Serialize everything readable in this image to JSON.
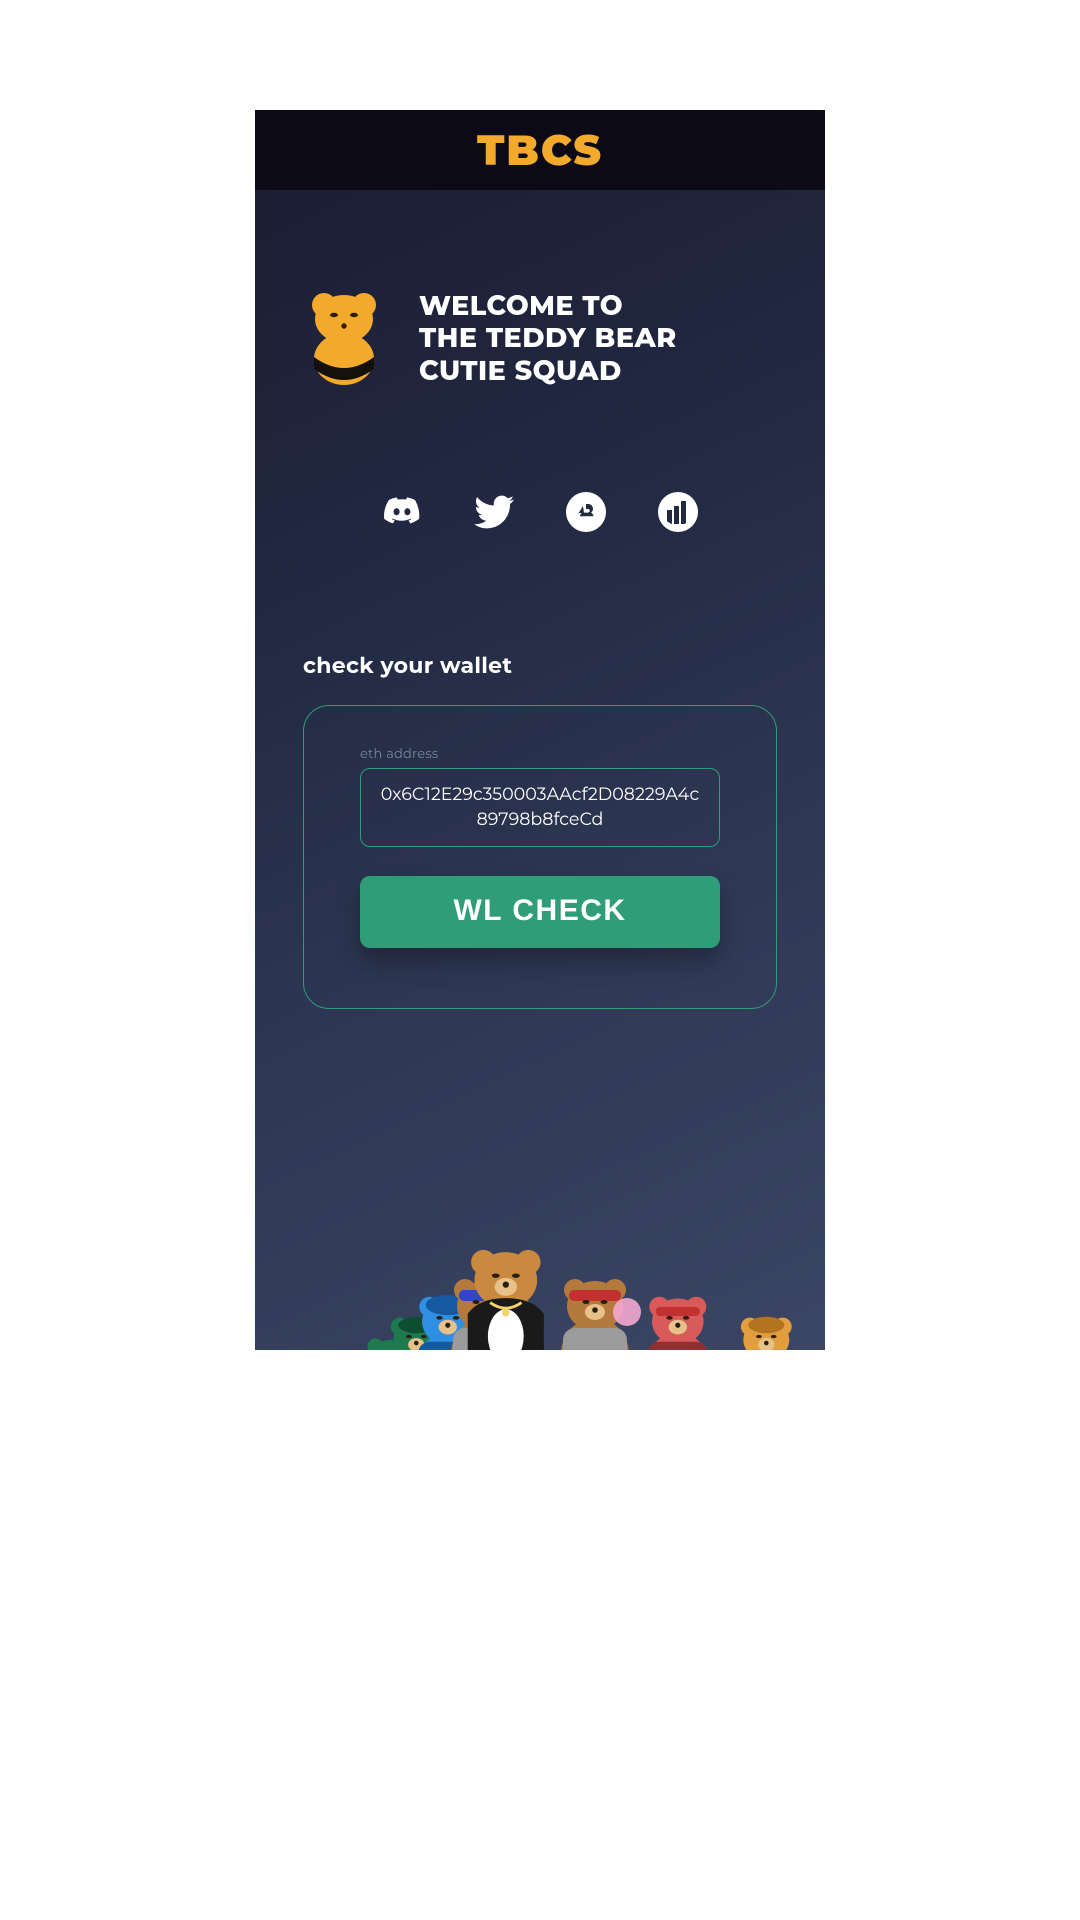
{
  "header": {
    "brand": "TBCS"
  },
  "hero": {
    "title": "WELCOME TO\nTHE TEDDY BEAR\nCUTIE SQUAD"
  },
  "socials": {
    "items": [
      {
        "name": "discord-icon"
      },
      {
        "name": "twitter-icon"
      },
      {
        "name": "opensea-icon"
      },
      {
        "name": "looksrare-icon"
      }
    ]
  },
  "wallet": {
    "section_title": "check your wallet",
    "field_label": "eth address",
    "address_value": "0x6C12E29c350003AAcf2D08229A4c89798b8fceCd",
    "button_label": "WL CHECK"
  },
  "colors": {
    "accent": "#f3a92b",
    "button": "#2f9d77",
    "border": "#2f9d77",
    "bg_dark": "#0d0a17"
  },
  "footer": {
    "bears": [
      {
        "body": "#1d7a4f",
        "accent": "#0e4d31"
      },
      {
        "body": "#1d7a4f",
        "accent": "#0e4d31"
      },
      {
        "body": "#2f8fe3",
        "accent": "#1559a0"
      },
      {
        "body": "#b4793c",
        "accent": "#3046c8"
      },
      {
        "body": "#c9893f",
        "accent": "#1a1a1a"
      },
      {
        "body": "#b4793c",
        "accent": "#c23030"
      },
      {
        "body": "#d85a5a",
        "accent": "#8f2f2f"
      },
      {
        "body": "#e29e3e",
        "accent": "#b3741f"
      },
      {
        "body": "#e29e3e",
        "accent": "#b3741f"
      }
    ]
  }
}
